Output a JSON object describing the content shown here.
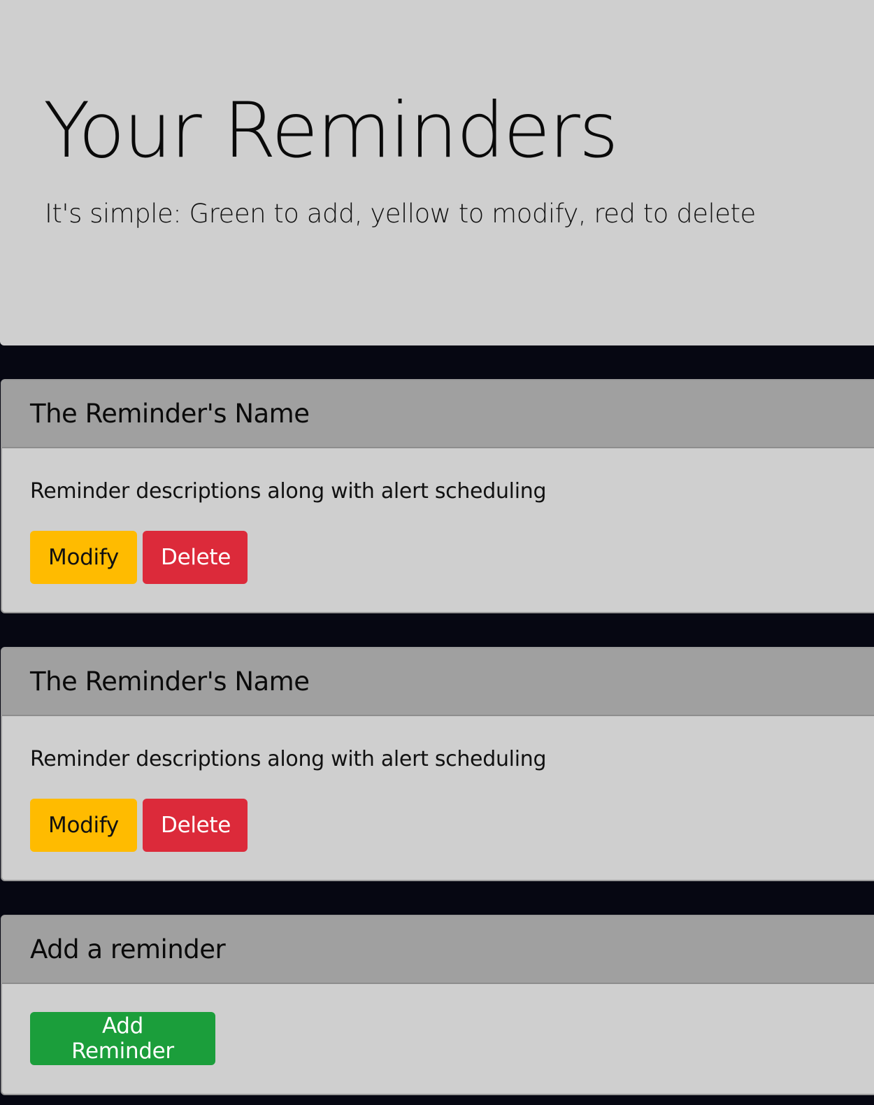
{
  "hero": {
    "title": "Your Reminders",
    "lead": "It's simple: Green to add, yellow to modify, red to delete"
  },
  "reminders": [
    {
      "name": "The Reminder's Name",
      "description": "Reminder descriptions along with alert scheduling",
      "modify_label": "Modify",
      "delete_label": "Delete"
    },
    {
      "name": "The Reminder's Name",
      "description": "Reminder descriptions along with alert scheduling",
      "modify_label": "Modify",
      "delete_label": "Delete"
    }
  ],
  "add_card": {
    "title": "Add a reminder",
    "button_label": "Add Reminder"
  },
  "colors": {
    "page_background": "#060712",
    "panel_background": "#cfcfcf",
    "card_header": "#a0a0a0",
    "add": "#1b9e3b",
    "modify": "#ffbb00",
    "delete": "#dc2a3a"
  }
}
